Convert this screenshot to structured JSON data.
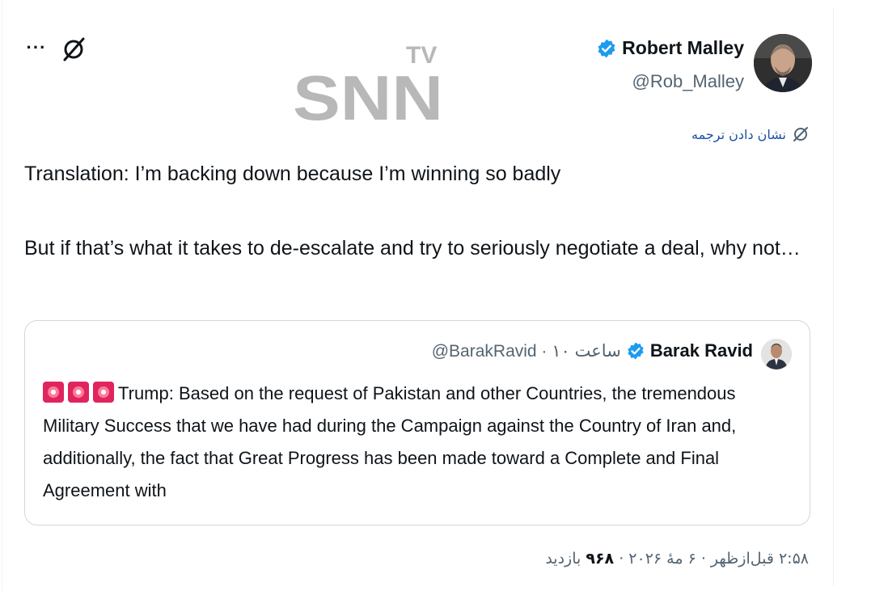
{
  "author": {
    "display_name": "Robert Malley",
    "handle": "@Rob_Malley",
    "verified": true
  },
  "translate_label": "نشان دادن ترجمه",
  "watermark": {
    "top": "TV",
    "main": "SNN"
  },
  "tweet": {
    "line1": "Translation: I’m backing down because I’m winning so badly",
    "line2": "But if that’s what it takes to de-escalate and try to seriously negotiate a deal, why not…"
  },
  "quote": {
    "display_name": "Barak Ravid",
    "meta": "@BarakRavid · ۱۰ ساعت",
    "verified": true,
    "emoji": [
      "rotating-light",
      "rotating-light",
      "rotating-light"
    ],
    "text": "Trump: Based on the request of Pakistan and other Countries, the tremendous Military Success that we have had during the Campaign against the Country of Iran and, additionally, the fact that Great Progress has been made toward a Complete and Final Agreement with"
  },
  "footer": {
    "time_date": "۲:۵۸ قبل‌ازظهر · ۶ مهٔ ۲۰۲۶ ·",
    "views_count": "۹۶۸",
    "views_label": "بازدید"
  },
  "colors": {
    "verified": "#1d9bf0",
    "text": "#0f1419",
    "secondary": "#536471",
    "link": "#1d4fa5",
    "border": "#cfd9de"
  },
  "icons": [
    "more-icon",
    "grok-icon",
    "verified-badge-icon",
    "translate-icon",
    "siren-emoji-icon"
  ]
}
